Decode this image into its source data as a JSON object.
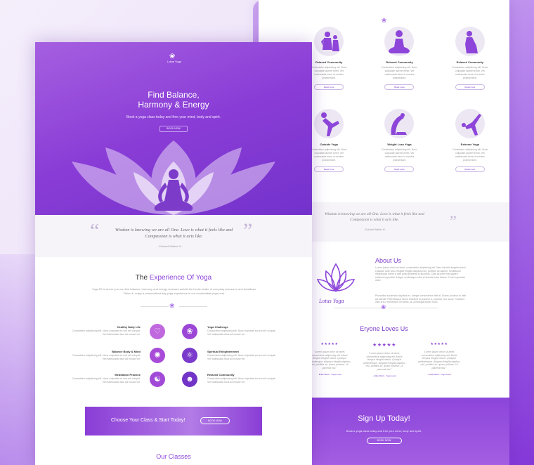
{
  "colors": {
    "accent": "#8d46d9",
    "dark_purple": "#7332cc",
    "light_bg": "#f6f4f8"
  },
  "back_page": {
    "cards": [
      {
        "title": "Relaxed Community",
        "text": "Contectetur adipisicing elit. Nunc vulputate laoreet emet. Vet malesuada risus ut montes praesentant.",
        "button": "Read more",
        "icon": "group-yoga-icon"
      },
      {
        "title": "Relaxed Community",
        "text": "Contectetur adipisicing elit. Nunc vulputate laoreet emet. Vet malesuada risus ut montes praesentant.",
        "button": "Read more",
        "icon": "lotus-pose-icon"
      },
      {
        "title": "Relaxed Community",
        "text": "Contectetur adipisicing elit. Nunc vulputate laoreet emet. Vet malesuada risus ut montes praesentant.",
        "button": "Read more",
        "icon": "kneeling-pose-icon"
      },
      {
        "title": "Outside Yoga",
        "text": "Contectetur adipisicing elit. Nunc vulputate laoreet emet. Vet malesuada risus ut montes praesentant.",
        "button": "Read more",
        "icon": "dancer-pose-icon"
      },
      {
        "title": "Weight Loss Yoga",
        "text": "Contectetur adipisicing elit. Nunc vulputate laoreet emet. Vet malesuada risus ut montes praesentant.",
        "button": "Read more",
        "icon": "backbend-pose-icon"
      },
      {
        "title": "Extreme Yoga",
        "text": "Contectetur adipisicing elit. Nunc vulputate laoreet emet. Vet malesuada risus ut montes praesentant.",
        "button": "Read more",
        "icon": "balance-pose-icon"
      }
    ],
    "quote": "Wisdom is knowing we are all One. Love is what it feels like and Compassion is what it acts like.",
    "quote_author": "- Eckhart Walker III -",
    "about": {
      "logo_text": "Lotus Yoga",
      "title": "About Us",
      "p1": "Lorem ipsum dolor sit amet, consectetur adipisicing elit. Nam lobortis fringilla lectus. Quisque ante arcu, feugiat fringilla dapibus non, porttitor ac sapien. Vestibulum malesuada lorem a velit porta pharetra in faucibus. Cras sit amet nisi sapien eleifend imperdiet. Integer scelerisque nibh et blandit tortor dictum. Proin imperdiet dolor.",
      "p2": "Phasellus accumsan dapibus ex. Integer consectetur velit at. Donec pulvinar in velit ad blandit. Pellentesque libero tincidunt id posuere a, pulvinar non lacus. Praesent nibh arcu, fermentum vel tellus, ac consequat turpis nunc."
    },
    "testimonials_title": "Eryone Loves Us",
    "testimonials": [
      {
        "stars": "★★★★★",
        "text": "\"Lorem ipsum dolor sit amet, consectetur adipiscing elit. Morbi tempus feugiat metus. Quisque pellentesque. Aliquam fringilla dapibus nisi, porttitor ac, quam pulvinar. Ut placerat nisi.\"",
        "author": "- Erika Ward - Yoga Lover"
      },
      {
        "stars": "★★★★★",
        "text": "\"Lorem ipsum dolor sit amet, consectetur adipiscing elit. Morbi tempus feugiat metus. Quisque pellentesque. Aliquam fringilla dapibus nisi, porttitor ac, quam pulvinar. Ut placerat nisi.\"",
        "author": "- Erika Ward - Yoga Lover"
      },
      {
        "stars": "★★★★★",
        "text": "\"Lorem ipsum dolor sit amet, consectetur adipiscing elit. Morbi tempus feugiat metus. Quisque pellentesque. Aliquam fringilla dapibus nisi, porttitor ac, quam pulvinar. Ut placerat nisi.\"",
        "author": "- Erika Ward - Yoga Lover"
      }
    ],
    "signup": {
      "title": "Sign Up Today!",
      "text": "Book a yoga class today and free your mind, body and spirit.",
      "button": "BOOK NOW"
    }
  },
  "front_page": {
    "logo_text": "Lotus Yoga",
    "hero_title_1": "Find Balance,",
    "hero_title_2": "Harmony & Energy",
    "hero_sub": "Book a yoga class today and free your mind, body and spirit.",
    "hero_button": "BOOK NOW",
    "quote": "Wisdom is knowing we are all One. Love is what it feels like and Compassion is what it acts like.",
    "quote_author": "- Eckhart Walker III -",
    "exp_title_1": "The ",
    "exp_title_2": "Experience Of Yoga",
    "exp_intro": "Yoga Fit is where you can find balance, harmony and energy renewed amidst the hectic bustle of everyday pressures and deadlines. Relax &, enjoy a personalized day yoga experience in our comfortable yoga-nest.",
    "features": [
      {
        "title": "Healthy Daily Life",
        "text": "Consectetur adipisicing elit. Nunc vulputate ea sub erit volupat. Vel malesuada risus ad mouse ver.",
        "icon": "heart-icon"
      },
      {
        "title": "Yoga Challenge",
        "text": "Consectetur adipisicing elit. Nunc vulputate ea sub erit volupat. Vel malesuada risus ad mouse ver.",
        "icon": "lotus-icon"
      },
      {
        "title": "Balance Body & Mind",
        "text": "Consectetur adipisicing elit. Nunc vulputate ea sub erit volupat. Vel malesuada risus ad mouse ver.",
        "icon": "brain-icon"
      },
      {
        "title": "Spiritual Enlightenment",
        "text": "Consectetur adipisicing elit. Nunc vulputate ea sub erit volupat. Vel malesuada risus ad mouse ver.",
        "icon": "atom-icon"
      },
      {
        "title": "Meditation Practice",
        "text": "Consectetur adipisicing elit. Nunc vulputate ea sub erit volupat. Vel malesuada risus ad mouse ver.",
        "icon": "meditation-icon"
      },
      {
        "title": "Relaxed Community",
        "text": "Consectetur adipisicing elit. Nunc vulputate ea sub erit volupat. Vel malesuada risus ad mouse ver.",
        "icon": "community-icon"
      }
    ],
    "banner_text": "Choose Your Class & Start Today!",
    "banner_button": "BOOK NOW",
    "classes_title_1": "Our ",
    "classes_title_2": "Classes"
  }
}
